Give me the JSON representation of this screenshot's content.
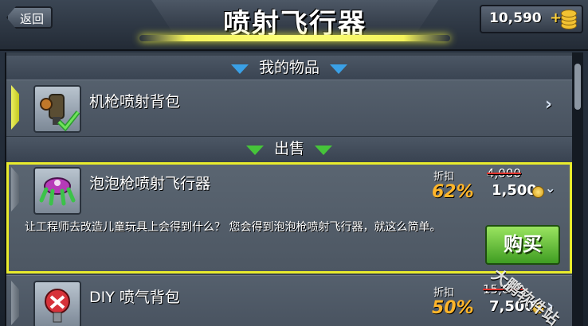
{
  "header": {
    "back_label": "返回",
    "title": "喷射飞行器",
    "currency": "10,590"
  },
  "sections": {
    "owned_label": "我的物品",
    "sale_label": "出售"
  },
  "owned_items": [
    {
      "name": "机枪喷射背包"
    }
  ],
  "sale_items": [
    {
      "name": "泡泡枪喷射飞行器",
      "discount_label": "折扣",
      "discount": "62%",
      "old_price": "4,000",
      "price": "1,500",
      "description": "让工程师去改造儿童玩具上会得到什么？ 您会得到泡泡枪喷射飞行器，就这么简单。",
      "buy_label": "购买"
    },
    {
      "name": "DIY 喷气背包",
      "discount_label": "折扣",
      "discount": "50%",
      "old_price": "15,000",
      "price": "7,500"
    }
  ],
  "watermark": "大鹏软件站",
  "colors": {
    "highlight": "#e9ec2c",
    "owned_triangle": "#3aa0e6",
    "sale_triangle": "#46c43a",
    "discount": "#ffb52a",
    "buy_button": "#6cc840"
  }
}
